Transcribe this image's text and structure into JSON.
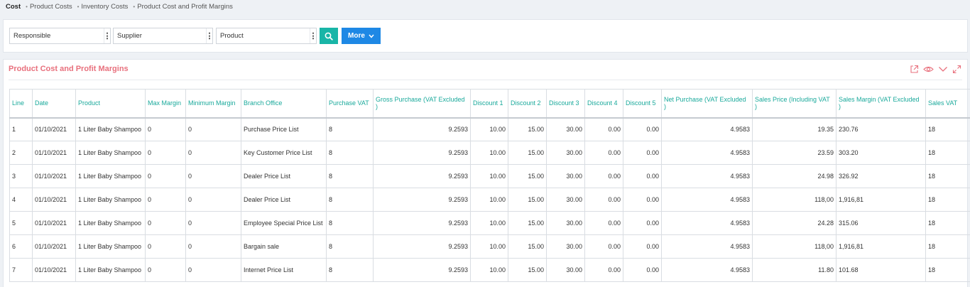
{
  "breadcrumb": {
    "root": "Cost",
    "items": [
      "Product Costs",
      "Inventory Costs",
      "Product Cost and Profit Margins"
    ]
  },
  "filters": {
    "responsible": "Responsible",
    "supplier": "Supplier",
    "product": "Product",
    "more_label": "More"
  },
  "report": {
    "title": "Product Cost and Profit Margins",
    "columns": [
      "Line",
      "Date",
      "Product",
      "Max Margin",
      "Minimum Margin",
      "Branch Office",
      "Purchase VAT",
      "Gross Purchase (VAT Excluded )",
      "Discount 1",
      "Discount 2",
      "Discount 3",
      "Discount 4",
      "Discount 5",
      "Net Purchase (VAT Excluded )",
      "Sales Price (Including VAT )",
      "Sales Margin (VAT Excluded )",
      "Sales VAT"
    ],
    "rows": [
      [
        "1",
        "01/10/2021",
        "1 Liter Baby Shampoo",
        "0",
        "0",
        "Purchase Price List",
        "8",
        "9.2593",
        "10.00",
        "15.00",
        "30.00",
        "0.00",
        "0.00",
        "4.9583",
        "19.35",
        "230.76",
        "18"
      ],
      [
        "2",
        "01/10/2021",
        "1 Liter Baby Shampoo",
        "0",
        "0",
        "Key Customer Price List",
        "8",
        "9.2593",
        "10.00",
        "15.00",
        "30.00",
        "0.00",
        "0.00",
        "4.9583",
        "23.59",
        "303.20",
        "18"
      ],
      [
        "3",
        "01/10/2021",
        "1 Liter Baby Shampoo",
        "0",
        "0",
        "Dealer Price List",
        "8",
        "9.2593",
        "10.00",
        "15.00",
        "30.00",
        "0.00",
        "0.00",
        "4.9583",
        "24.98",
        "326.92",
        "18"
      ],
      [
        "4",
        "01/10/2021",
        "1 Liter Baby Shampoo",
        "0",
        "0",
        "Dealer Price List",
        "8",
        "9.2593",
        "10.00",
        "15.00",
        "30.00",
        "0.00",
        "0.00",
        "4.9583",
        "118,00",
        "1,916,81",
        "18"
      ],
      [
        "5",
        "01/10/2021",
        "1 Liter Baby Shampoo",
        "0",
        "0",
        "Employee Special Price List",
        "8",
        "9.2593",
        "10.00",
        "15.00",
        "30.00",
        "0.00",
        "0.00",
        "4.9583",
        "24.28",
        "315.06",
        "18"
      ],
      [
        "6",
        "01/10/2021",
        "1 Liter Baby Shampoo",
        "0",
        "0",
        "Bargain sale",
        "8",
        "9.2593",
        "10.00",
        "15.00",
        "30.00",
        "0.00",
        "0.00",
        "4.9583",
        "118,00",
        "1,916,81",
        "18"
      ],
      [
        "7",
        "01/10/2021",
        "1 Liter Baby Shampoo",
        "0",
        "0",
        "Internet Price List",
        "8",
        "9.2593",
        "10.00",
        "15.00",
        "30.00",
        "0.00",
        "0.00",
        "4.9583",
        "11.80",
        "101.68",
        "18"
      ]
    ]
  },
  "colors": {
    "title": "#e8707d",
    "header_text": "#19a99b",
    "search_button": "#19b5a7",
    "more_button": "#1e88e5",
    "margin_link": "#2a4bd0"
  },
  "icons": [
    "search-icon",
    "chevron-down-icon",
    "export-icon",
    "eye-icon",
    "collapse-icon",
    "expand-icon"
  ]
}
